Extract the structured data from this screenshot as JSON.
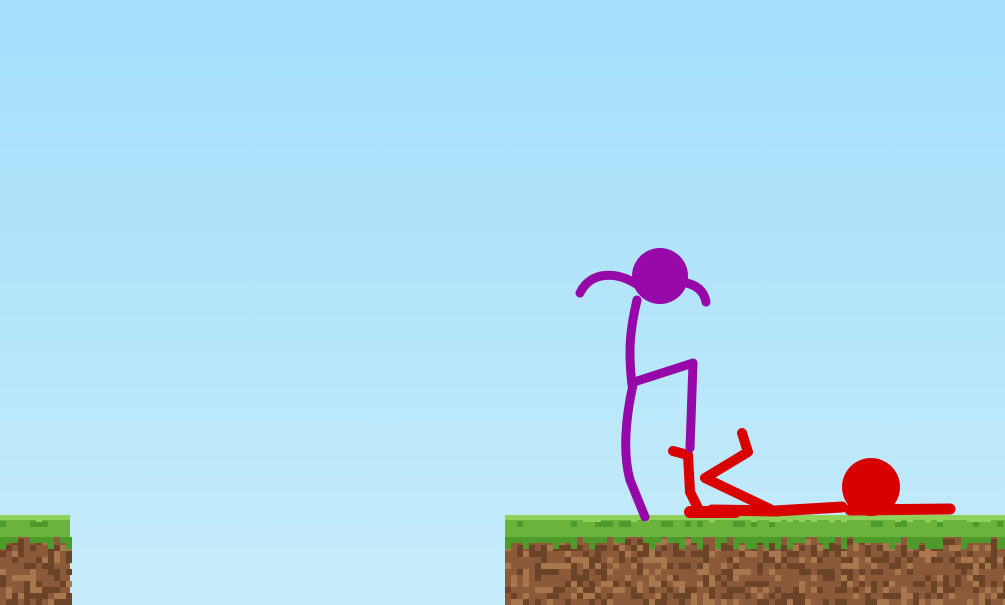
{
  "scene": {
    "colors": {
      "sky_top": "#A3DEFB",
      "sky_bottom": "#C6ECFA",
      "grass": "#6BB33A",
      "grass_dark": "#4E9A2A",
      "grass_light": "#8FD25A",
      "dirt": "#8A5A3A",
      "dirt_dark": "#6B4428",
      "dirt_light": "#A8774E",
      "stick_purple": "#9708A8",
      "stick_red": "#D90000"
    },
    "characters": [
      {
        "name": "purple-stickman",
        "pose": "standing",
        "color_key": "stick_purple"
      },
      {
        "name": "red-stickman",
        "pose": "lying-down",
        "color_key": "stick_red"
      }
    ],
    "platforms": [
      {
        "name": "left-grass-block",
        "material": "grass-dirt"
      },
      {
        "name": "right-grass-block",
        "material": "grass-dirt"
      }
    ]
  }
}
